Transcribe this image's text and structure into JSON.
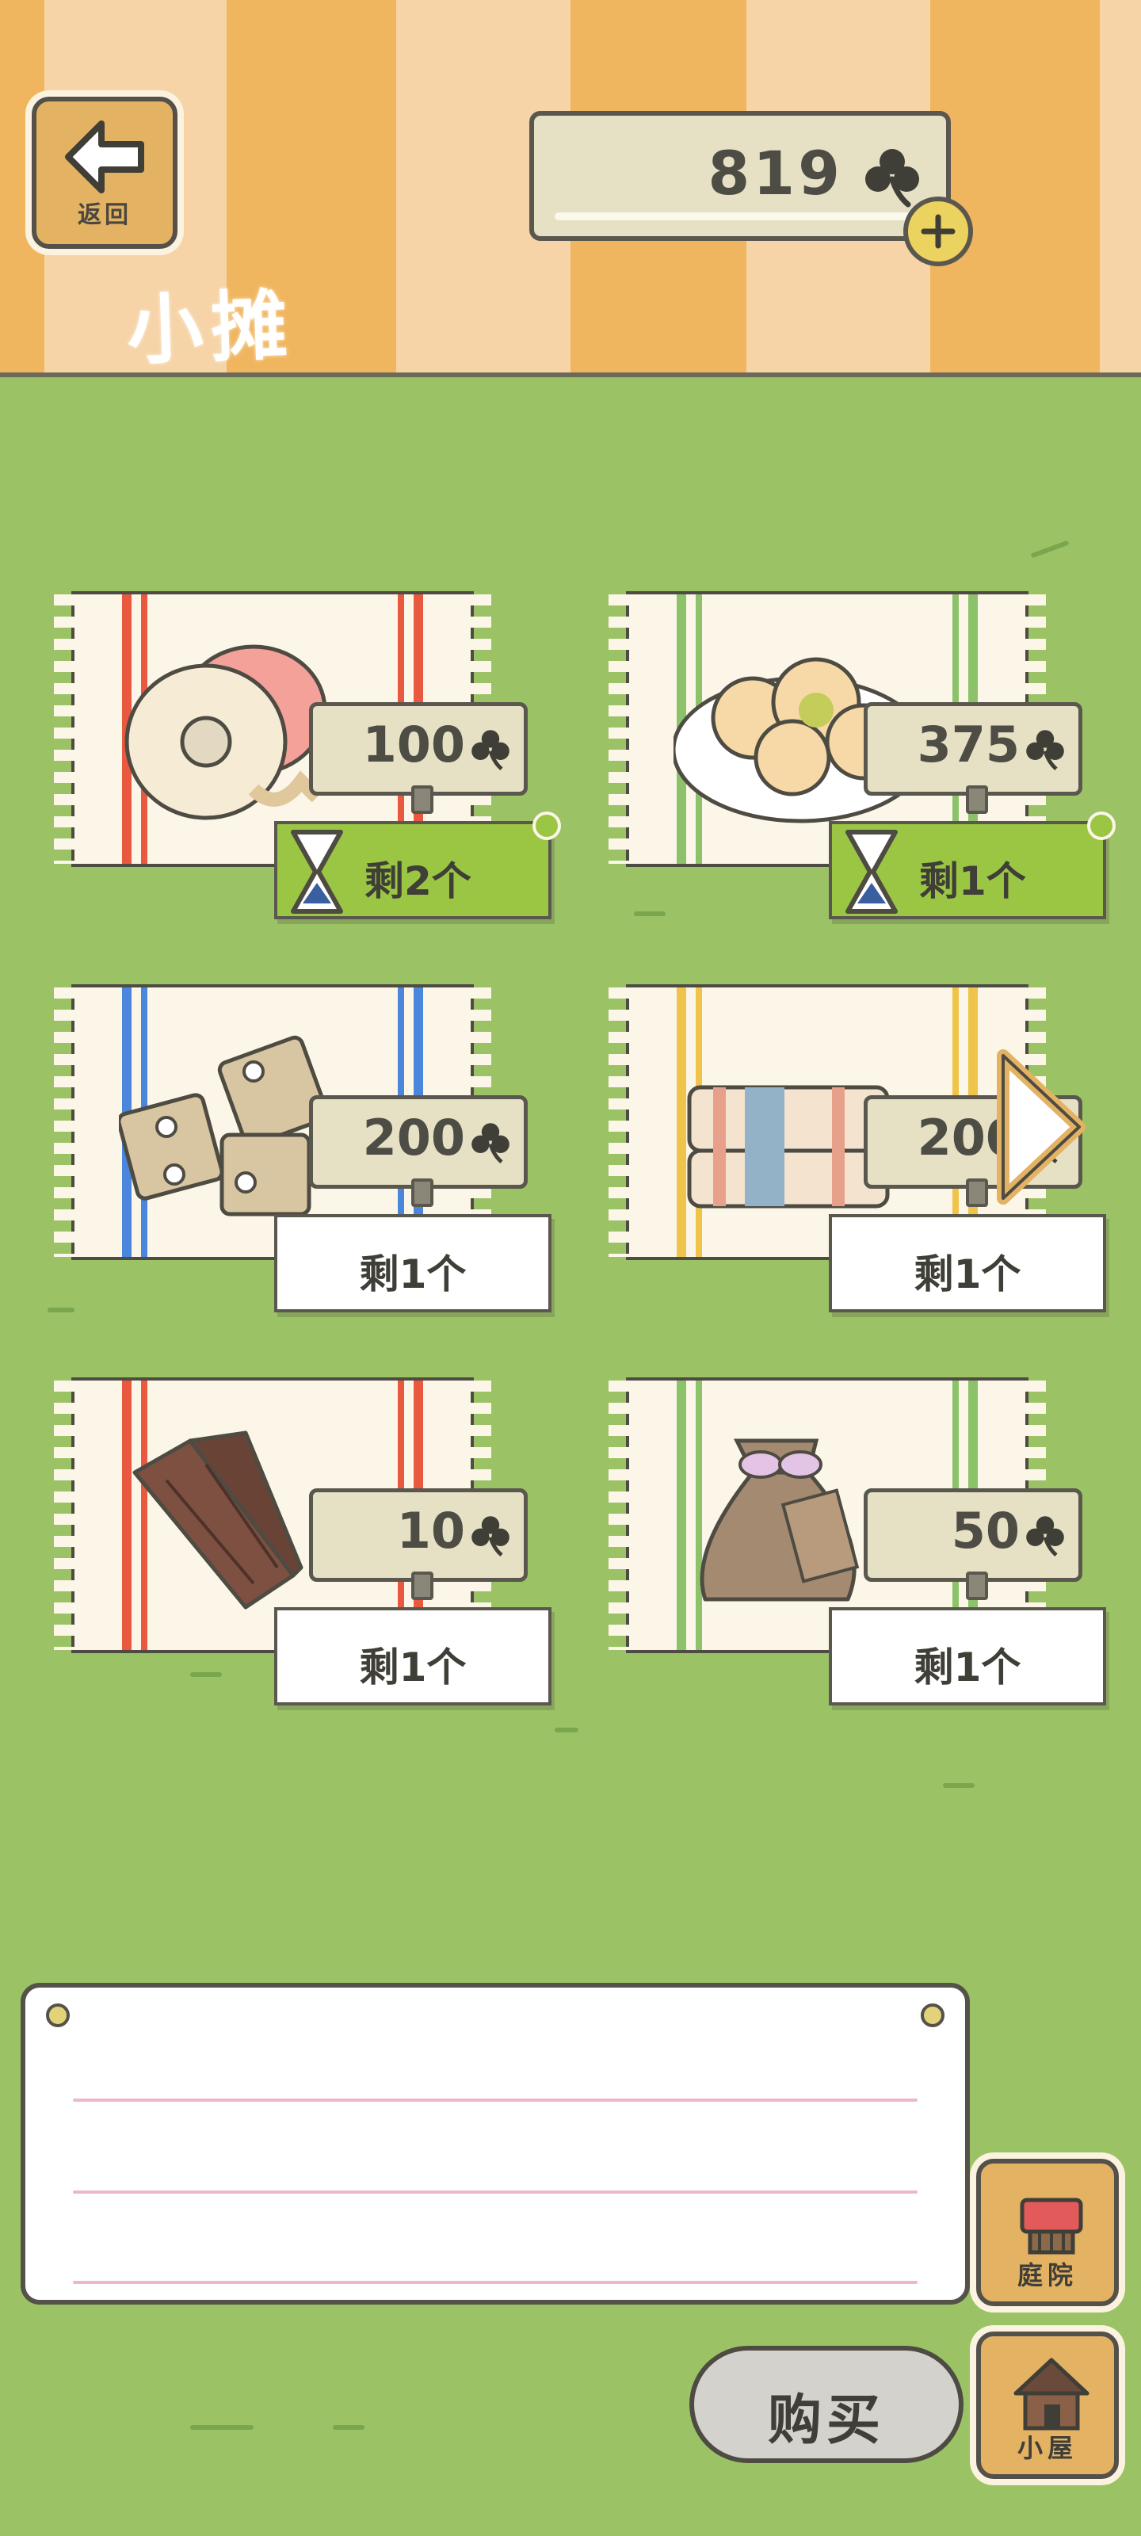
{
  "header": {
    "back_label": "返回",
    "title": "小摊",
    "currency": {
      "value": "819",
      "icon": "clover-icon"
    },
    "add_icon": "plus-icon"
  },
  "items": [
    {
      "name": "tape-roll",
      "price": "100",
      "stock": "剩2个",
      "timed": true,
      "stripe": "#e8593f"
    },
    {
      "name": "dumplings",
      "price": "375",
      "stock": "剩1个",
      "timed": true,
      "stripe": "#8cc36a"
    },
    {
      "name": "hinges",
      "price": "200",
      "stock": "剩1个",
      "timed": false,
      "stripe": "#4a86dc"
    },
    {
      "name": "folded-cloth",
      "price": "200",
      "stock": "剩1个",
      "timed": false,
      "stripe": "#f0c44a"
    },
    {
      "name": "wood-log",
      "price": "10",
      "stock": "剩1个",
      "timed": false,
      "stripe": "#e8593f"
    },
    {
      "name": "seed-bag",
      "price": "50",
      "stock": "剩1个",
      "timed": false,
      "stripe": "#8cc36a"
    }
  ],
  "message": {
    "text": ""
  },
  "buy_label": "购买",
  "side": {
    "yard_label": "庭院",
    "house_label": "小屋"
  },
  "colors": {
    "grass": "#9bc366",
    "stripe_dark": "#f0b65f",
    "stripe_light": "#f6d4a8",
    "wood": "#e3b263",
    "timed_tag": "#9bc643"
  }
}
